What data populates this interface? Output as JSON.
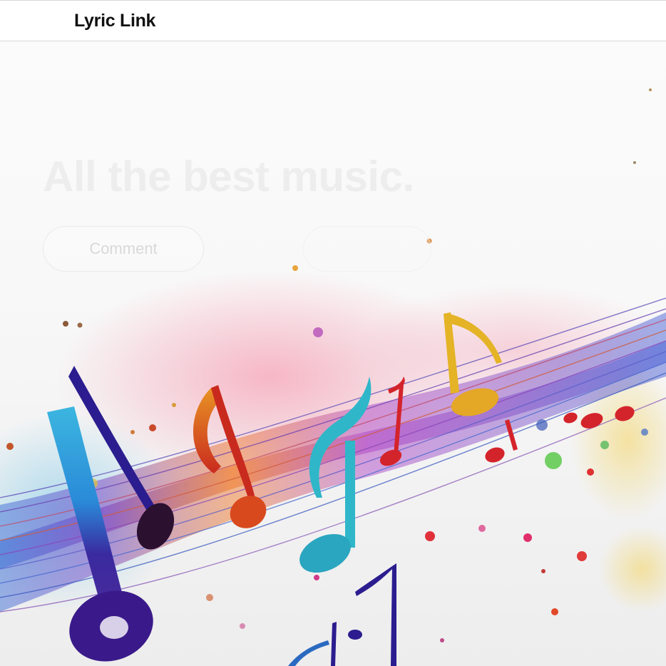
{
  "nav": {
    "brand": "Lyric Link"
  },
  "hero": {
    "title": "All the best music.",
    "comment_button_label": "Comment",
    "background_art": "colorful-music-notes-illustration"
  },
  "colors": {
    "nav_background": "#ffffff",
    "brand_text": "#111111",
    "hero_background": "#f8f8f8",
    "notes": [
      "#2b1d8f",
      "#d8541a",
      "#2fb7c9",
      "#d4242b",
      "#e4b326",
      "#8a3fbf"
    ]
  }
}
